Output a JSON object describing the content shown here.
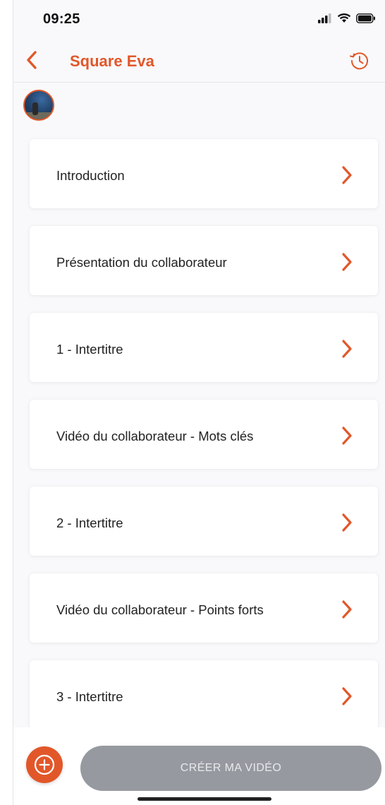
{
  "status_bar": {
    "time": "09:25"
  },
  "navbar": {
    "title": "Square Eva"
  },
  "sections": [
    {
      "label": "Introduction"
    },
    {
      "label": "Présentation du collaborateur"
    },
    {
      "label": "1 - Intertitre"
    },
    {
      "label": "Vidéo du collaborateur -  Mots clés"
    },
    {
      "label": "2 - Intertitre"
    },
    {
      "label": "Vidéo du collaborateur -  Points forts"
    },
    {
      "label": "3 - Intertitre"
    }
  ],
  "bottom": {
    "create_label": "CRÉER MA VIDÉO"
  },
  "colors": {
    "accent": "#e2572a",
    "button_disabled": "#9699a0",
    "background": "#f9f9fb"
  },
  "icons": {
    "back": "chevron-left-icon",
    "history": "history-clock-icon",
    "row_chevron": "chevron-right-icon",
    "add": "plus-circle-icon"
  }
}
